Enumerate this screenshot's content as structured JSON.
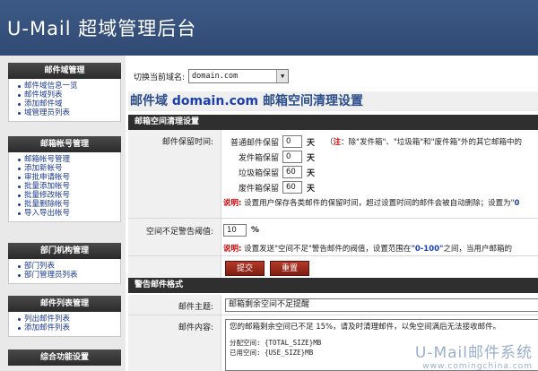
{
  "header": {
    "title": "U-Mail 超域管理后台"
  },
  "sidebar": {
    "sections": [
      {
        "title": "邮件域管理",
        "items": [
          "邮件域信息一览",
          "邮件域列表",
          "添加邮件域",
          "域管理员列表"
        ]
      },
      {
        "title": "邮箱帐号管理",
        "items": [
          "邮箱帐号管理",
          "添加新帐号",
          "审批申请帐号",
          "批量添加帐号",
          "批量修改帐号",
          "批量删除帐号",
          "导入导出帐号"
        ]
      },
      {
        "title": "部门机构管理",
        "items": [
          "部门列表",
          "部门管理员列表"
        ]
      },
      {
        "title": "邮件列表管理",
        "items": [
          "列出邮件列表",
          "添加邮件列表"
        ]
      },
      {
        "title": "综合功能设置",
        "items": []
      }
    ]
  },
  "main": {
    "domain_switch": {
      "label": "切换当前域名:",
      "value": "domain.com",
      "arrow": "▼"
    },
    "page_title": {
      "prefix": "邮件域",
      "domain": "domain.com",
      "suffix": "邮箱空间清理设置"
    },
    "cleanup": {
      "heading": "邮箱空间清理设置",
      "keep_label": "邮件保留时间:",
      "rows": [
        {
          "name": "普通邮件保留",
          "value": "0",
          "unit": "天"
        },
        {
          "name": "发件箱保留",
          "value": "0",
          "unit": "天"
        },
        {
          "name": "垃圾箱保留",
          "value": "60",
          "unit": "天"
        },
        {
          "name": "废件箱保留",
          "value": "60",
          "unit": "天"
        }
      ],
      "note_prefix": "（",
      "note_mark": "注",
      "note_text": "：除\"发件箱\"、\"垃圾箱\"和\"废件箱\"外的其它邮箱中的",
      "desc1_label": "说明:",
      "desc1_text": "设置用户保存各类邮件的保留时间，超过设置时间的邮件会被自动删除；设置为\"",
      "desc1_end": "0",
      "threshold_label": "空间不足警告阈值:",
      "threshold_value": "10",
      "threshold_unit": "%",
      "desc2_label": "说明:",
      "desc2_text": "设置发送\"空间不足\"警告邮件的阀值，设置范围在",
      "desc2_range": "\"0-100\"",
      "desc2_end": "之间，当用户邮箱的",
      "submit_label": "提交",
      "reset_label": "重置"
    },
    "warning": {
      "heading": "警告邮件格式",
      "subject_label": "邮件主题:",
      "subject_value": "邮箱剩余空间不足提醒",
      "content_label": "邮件内容:",
      "content_line1": "您的邮箱剩余空间已不足 15%，请及时清理邮件，以免空间满后无法接收邮件。",
      "content_line2": "分配空间: {TOTAL_SIZE}MB",
      "content_line3": "已用空间: {USE_SIZE}MB"
    }
  },
  "watermark": {
    "line1": "U-Mail邮件系统",
    "line2": "www.comingchina.com"
  }
}
